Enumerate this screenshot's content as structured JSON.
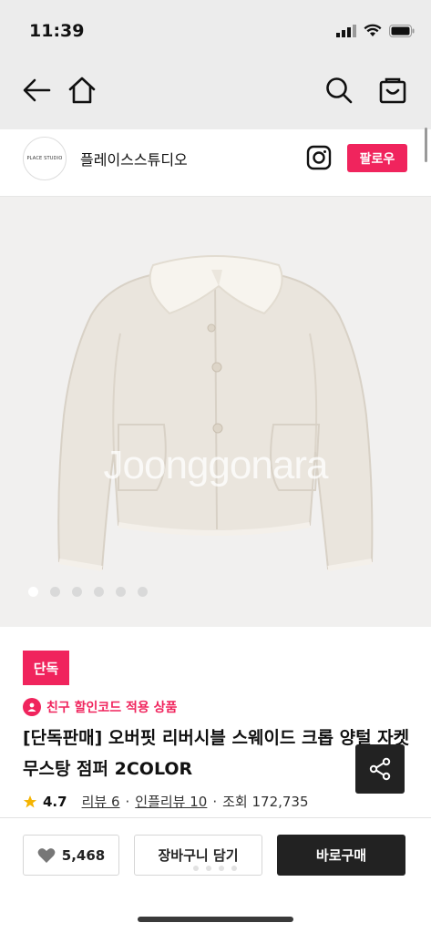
{
  "status_bar": {
    "time": "11:39",
    "icons": [
      "signal-icon",
      "wifi-icon",
      "battery-icon"
    ]
  },
  "nav": {
    "icons": [
      "back-arrow-icon",
      "home-icon",
      "search-icon",
      "cart-icon"
    ]
  },
  "store": {
    "logo_text": "PLACE STUDIO",
    "name": "플레이스스튜디오",
    "follow_label": "팔로우"
  },
  "gallery": {
    "watermark": "Joonggonara",
    "image_count": 6,
    "active_index": 0
  },
  "product": {
    "badge": "단독",
    "promo": "친구 할인코드 적용 상품",
    "title": "[단독판매] 오버핏 리버시블 스웨이드 크롭 양털 자켓 무스탕 점퍼 2COLOR",
    "rating": "4.7",
    "reviews": "리뷰 6",
    "influencer_reviews": "인플리뷰 10",
    "views": "조회 172,735"
  },
  "actions": {
    "likes": "5,468",
    "cart_label": "장바구니 담기",
    "buy_label": "바로구매"
  },
  "colors": {
    "accent": "#f0245d",
    "dark": "#222222",
    "background_top": "#ececec"
  }
}
